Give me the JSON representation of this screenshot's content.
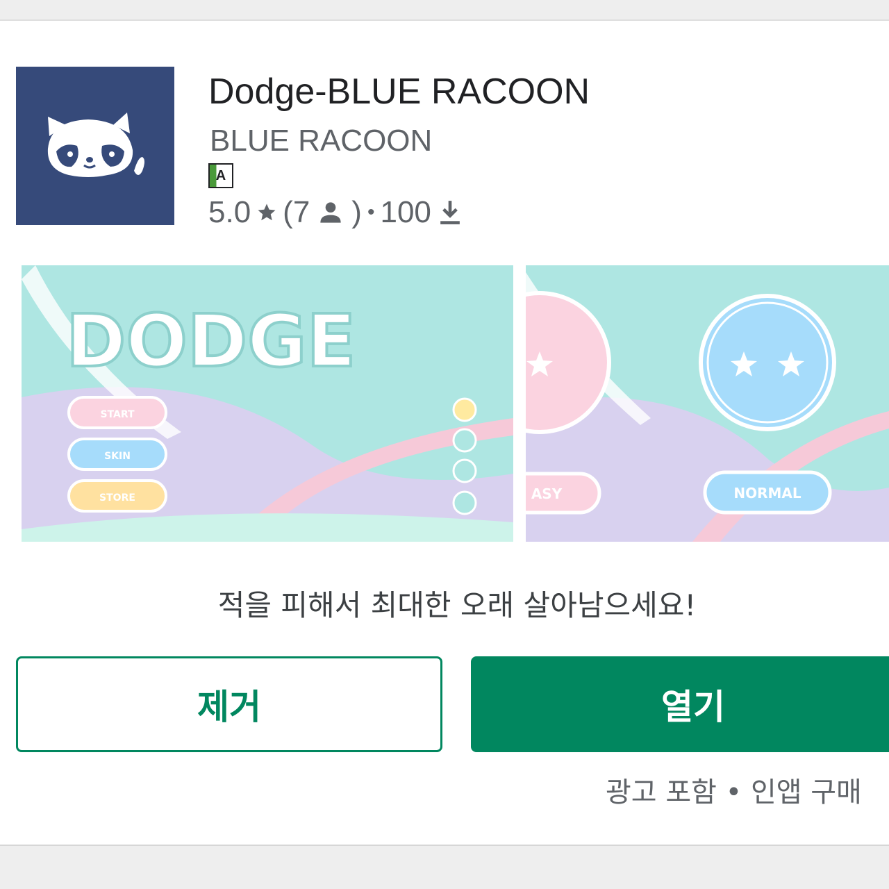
{
  "app": {
    "title": "Dodge-BLUE RACOON",
    "developer": "BLUE RACOON",
    "age_rating_badge": "A"
  },
  "rating": {
    "score": "5.0",
    "star_icon": "star-icon",
    "reviews_open": "(7",
    "reviewer_icon": "person-icon",
    "reviews_close": ")",
    "separator": "•",
    "downloads": "100",
    "download_icon": "download-icon"
  },
  "screenshots": [
    {
      "title_text": "DODGE",
      "buttons": [
        "START",
        "SKIN",
        "STORE"
      ]
    },
    {
      "buttons": [
        "EASY",
        "NORMAL"
      ],
      "visible_button_text": [
        "ASY",
        "NORMAL"
      ]
    }
  ],
  "description": "적을 피해서 최대한 오래 살아남으세요!",
  "actions": {
    "remove_label": "제거",
    "open_label": "열기"
  },
  "notice": "광고 포함 • 인앱 구매",
  "colors": {
    "icon_background": "#364a7a",
    "primary_green": "#01875f",
    "screenshot_teal": "#aee6e2",
    "screenshot_lavender": "#d8d1ef"
  }
}
